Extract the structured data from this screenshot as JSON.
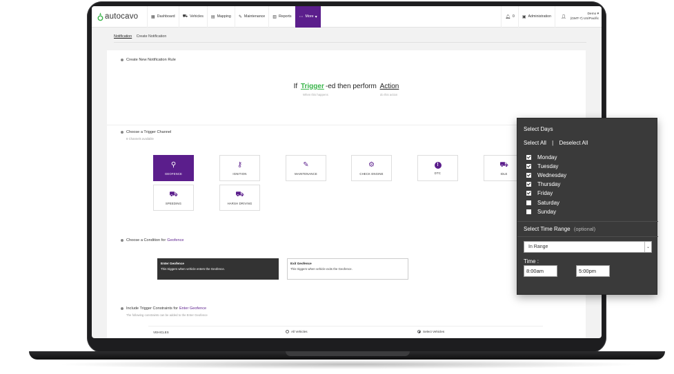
{
  "brand": {
    "name": "autocavo",
    "accent": "#5b1e8c",
    "green": "#39b54a"
  },
  "nav": {
    "items": [
      {
        "label": "Dashboard",
        "icon": "dashboard-icon"
      },
      {
        "label": "Vehicles",
        "icon": "car-icon"
      },
      {
        "label": "Mapping",
        "icon": "map-icon"
      },
      {
        "label": "Maintenance",
        "icon": "wrench-icon"
      },
      {
        "label": "Reports",
        "icon": "report-icon"
      },
      {
        "label": "More",
        "icon": "more-icon"
      }
    ],
    "alerts_count": "0",
    "admin_label": "Administration",
    "user_name": "Demo",
    "user_timezone": "(GMT-7) US/Pacific"
  },
  "breadcrumb": {
    "parent": "Notification",
    "current": "Create Notification"
  },
  "rule": {
    "section_title": "Create New Notification Rule",
    "if_word": "If",
    "trigger_word": "Trigger",
    "middle_text": "-ed then perform",
    "action_word": "Action",
    "trigger_hint": "When this happens",
    "action_hint": "do this action"
  },
  "trigger_channel": {
    "title": "Choose a Trigger Channel",
    "subtitle": "8 Channels available",
    "channels": [
      {
        "label": "GEOFENCE",
        "icon": "location-pin-icon",
        "glyph": "⚲"
      },
      {
        "label": "IGNITION",
        "icon": "key-icon",
        "glyph": "⚷"
      },
      {
        "label": "MAINTENANCE",
        "icon": "wrench-icon",
        "glyph": "✎"
      },
      {
        "label": "CHECK ENGINE",
        "icon": "engine-icon",
        "glyph": "⚙"
      },
      {
        "label": "DTC",
        "icon": "alert-circle-icon",
        "glyph": "!"
      },
      {
        "label": "IDLE",
        "icon": "car-icon",
        "glyph": "⛟"
      },
      {
        "label": "SPEEDING",
        "icon": "car-icon",
        "glyph": "⛟"
      },
      {
        "label": "HARSH DRIVING",
        "icon": "car-icon",
        "glyph": "⛟"
      }
    ]
  },
  "condition": {
    "title_prefix": "Choose a Condition for",
    "title_accent": "Geofence",
    "options": [
      {
        "title": "Enter Geofence",
        "desc": "This triggers when vehicle enters the Geofence."
      },
      {
        "title": "Exit Geofence",
        "desc": "This triggers when vehicle exits the Geofence."
      }
    ]
  },
  "constraints": {
    "title_prefix": "Include Trigger Constraints for",
    "title_accent": "Enter Geofence",
    "subtitle": "The following constraints can be added to the Enter Geofence",
    "vehicles_label": "VEHICLES",
    "all_vehicles": "All Vehicles",
    "select_vehicles": "Select Vehicles"
  },
  "days_panel": {
    "title": "Select Days",
    "select_all": "Select All",
    "separator": "|",
    "deselect_all": "Deselect All",
    "days": [
      {
        "label": "Monday",
        "checked": true
      },
      {
        "label": "Tuesday",
        "checked": true
      },
      {
        "label": "Wednesday",
        "checked": true
      },
      {
        "label": "Thursday",
        "checked": true
      },
      {
        "label": "Friday",
        "checked": true
      },
      {
        "label": "Saturday",
        "checked": false
      },
      {
        "label": "Sunday",
        "checked": false
      }
    ],
    "time_range_label": "Select Time Range",
    "time_range_optional": "(optional)",
    "range_value": "In Range",
    "time_label": "Time :",
    "start_time": "8:00am",
    "end_time": "5:00pm"
  }
}
